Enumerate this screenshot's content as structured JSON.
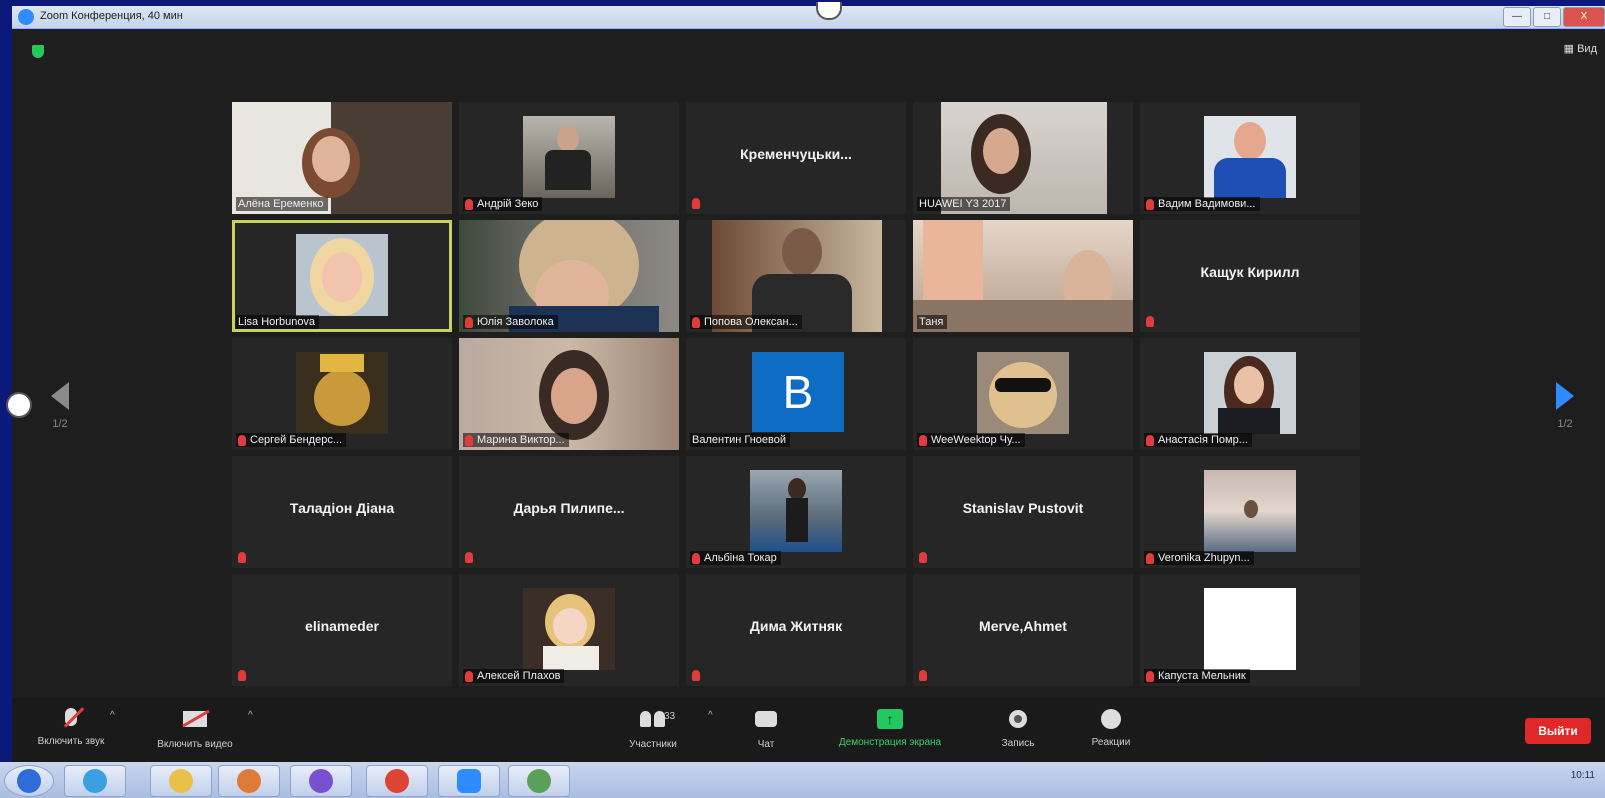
{
  "window": {
    "title": "Zoom Конференция, 40 мин",
    "view_label": "Вид",
    "buttons": [
      "—",
      "□",
      "X"
    ]
  },
  "navigation": {
    "left_page": "1/2",
    "right_page": "1/2"
  },
  "participants": [
    {
      "name": "Алёна Еременко",
      "muted": false,
      "video": true
    },
    {
      "name": "Андрій Зеко",
      "muted": true,
      "video": true
    },
    {
      "name": "Кременчуцьки...",
      "muted": true,
      "video": false
    },
    {
      "name": "HUAWEI Y3 2017",
      "muted": false,
      "video": true
    },
    {
      "name": "Вадим Вадимови...",
      "muted": true,
      "video": true
    },
    {
      "name": "Lisa Horbunova",
      "muted": false,
      "video": true,
      "active": true
    },
    {
      "name": "Юлія Заволока",
      "muted": true,
      "video": true
    },
    {
      "name": "Попова Олексан...",
      "muted": true,
      "video": true
    },
    {
      "name": "Таня",
      "muted": false,
      "video": true
    },
    {
      "name": "Кащук Кирилл",
      "muted": true,
      "video": false
    },
    {
      "name": "Сергей Бендерс...",
      "muted": true,
      "video": true
    },
    {
      "name": "Марина Виктор...",
      "muted": true,
      "video": true
    },
    {
      "name": "Валентин Гноевой",
      "muted": false,
      "video": false,
      "avatar_letter": "B"
    },
    {
      "name": "WeeWeektop Чу...",
      "muted": true,
      "video": true
    },
    {
      "name": "Анастасія Помр...",
      "muted": true,
      "video": true
    },
    {
      "name": "Таладіон Діана",
      "muted": true,
      "video": false
    },
    {
      "name": "Дарья Пилипе...",
      "muted": true,
      "video": false
    },
    {
      "name": "Альбіна Токар",
      "muted": true,
      "video": true
    },
    {
      "name": "Stanislav Pustovit",
      "muted": true,
      "video": false
    },
    {
      "name": "Veronika Zhupyn...",
      "muted": true,
      "video": true
    },
    {
      "name": "elinameder",
      "muted": true,
      "video": false
    },
    {
      "name": "Алексей Плахов",
      "muted": true,
      "video": true
    },
    {
      "name": "Дима Житняк",
      "muted": true,
      "video": false
    },
    {
      "name": "Merve,Ahmet",
      "muted": true,
      "video": false
    },
    {
      "name": "Капуста Мельник",
      "muted": true,
      "video": true
    }
  ],
  "toolbar": {
    "unmute_label": "Включить звук",
    "start_video_label": "Включить видео",
    "participants_label": "Участники",
    "participants_count": "33",
    "chat_label": "Чат",
    "share_label": "Демонстрация экрана",
    "record_label": "Запись",
    "reactions_label": "Реакции",
    "leave_label": "Выйти"
  },
  "taskbar": {
    "clock": "10:11"
  },
  "colors": {
    "active_speaker": "#c7d35a",
    "share_green": "#23c95e",
    "leave_red": "#e02828",
    "muted_red": "#e23b3b"
  }
}
